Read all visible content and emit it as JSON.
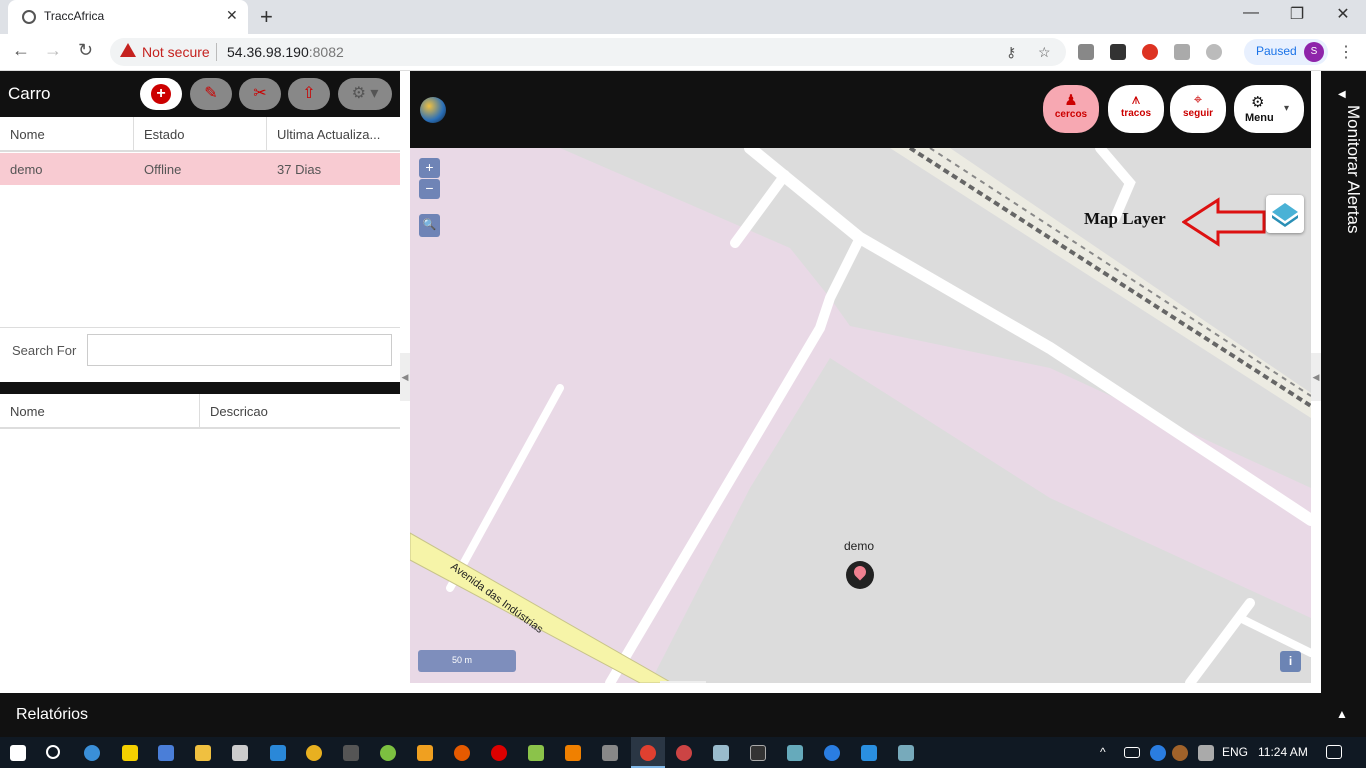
{
  "browser": {
    "tab_title": "TraccAfrica",
    "tab_close": "✕",
    "new_tab": "+",
    "window_controls": {
      "minimize": "—",
      "restore": "❐",
      "close": "✕"
    },
    "nav": {
      "back": "←",
      "forward": "→",
      "reload": "↻"
    },
    "security_label": "Not secure",
    "url_host": "54.36.98.190",
    "url_port": ":8082",
    "profile_status": "Paused",
    "profile_initial": "S",
    "menu": "⋮"
  },
  "left_panel": {
    "title": "Carro",
    "tool_icons": {
      "add": "+",
      "edit": "✎",
      "cut": "✂",
      "upload": "⇧",
      "settings": "⚙ ▾"
    },
    "columns": [
      "Nome",
      "Estado",
      "Ultima Actualiza..."
    ],
    "rows": [
      {
        "nome": "demo",
        "estado": "Offline",
        "ultima": "37 Dias"
      }
    ],
    "search_label": "Search For",
    "search_value": "",
    "lower_columns": [
      "Nome",
      "Descricao"
    ]
  },
  "map_toolbar": {
    "buttons": [
      {
        "label": "cercos",
        "icon": "♟"
      },
      {
        "label": "tracos",
        "icon": "⩚"
      },
      {
        "label": "seguir",
        "icon": "⌖"
      }
    ],
    "menu_label": "Menu",
    "menu_icon": "⚙",
    "menu_caret": "▾"
  },
  "map": {
    "zoom_in": "+",
    "zoom_out": "−",
    "search_icon": "🔍",
    "annotation": "Map Layer",
    "street_name": "Avenida das Indústrias",
    "marker_label": "demo",
    "scale": "50 m",
    "info": "i"
  },
  "right_panel": {
    "title": "Monitorar Alertas",
    "arrow": "◀"
  },
  "bottom_bar": {
    "title": "Relatórios",
    "caret": "▲"
  },
  "taskbar": {
    "language": "ENG",
    "time": "11:24 AM"
  },
  "colors": {
    "accent_red": "#cc0000",
    "active_button": "#f7a8b2",
    "selected_row": "#f8cbd2",
    "dark_bar": "#111111"
  }
}
